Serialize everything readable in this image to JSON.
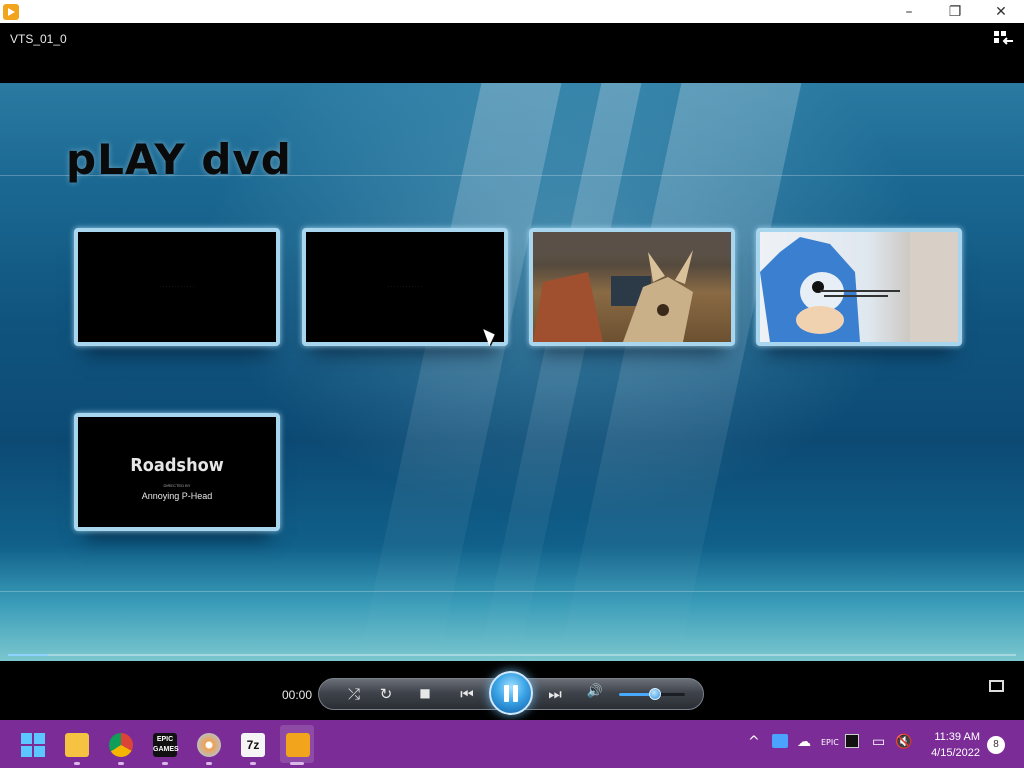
{
  "window": {
    "title": "",
    "controls": {
      "minimize": "–",
      "maximize": "❐",
      "close": "✕"
    }
  },
  "player": {
    "file_title": "VTS_01_0",
    "menu_title": "pLAY dvd",
    "thumbnails": [
      {
        "id": "clip-1",
        "caption": "",
        "content": "black frame"
      },
      {
        "id": "clip-2",
        "caption": "",
        "content": "black frame"
      },
      {
        "id": "clip-3",
        "caption": "",
        "content": "fox scene"
      },
      {
        "id": "clip-4",
        "caption": "",
        "content": "hedgehog scene"
      },
      {
        "id": "clip-5",
        "title": "Roadshow",
        "directed_by": "DIRECTED BY",
        "author": "Annoying P-Head"
      }
    ],
    "progress": 0.04,
    "time": "00:00",
    "volume": 0.55,
    "controls": {
      "shuffle": "⤮",
      "repeat": "↻",
      "stop": "■",
      "previous": "⏮",
      "next": "⏭",
      "mute": "🔊"
    }
  },
  "taskbar": {
    "clock_time": "11:39 AM",
    "clock_date": "4/15/2022",
    "notification_count": "8",
    "apps": [
      {
        "name": "start",
        "icon": "windows-icon"
      },
      {
        "name": "file-explorer",
        "icon": "folder-icon"
      },
      {
        "name": "chrome",
        "icon": "chrome-icon"
      },
      {
        "name": "epic-games",
        "icon": "epic-games-icon",
        "label": "EPIC\nGAMES"
      },
      {
        "name": "dvd-player",
        "icon": "disc-icon"
      },
      {
        "name": "7zip",
        "icon": "7zip-icon",
        "label": "7z"
      },
      {
        "name": "media-player",
        "icon": "media-player-icon"
      }
    ]
  },
  "colors": {
    "taskbar": "#7b2c96",
    "accent": "#3ca4e6",
    "thumb_border": "#a8d6ee"
  }
}
